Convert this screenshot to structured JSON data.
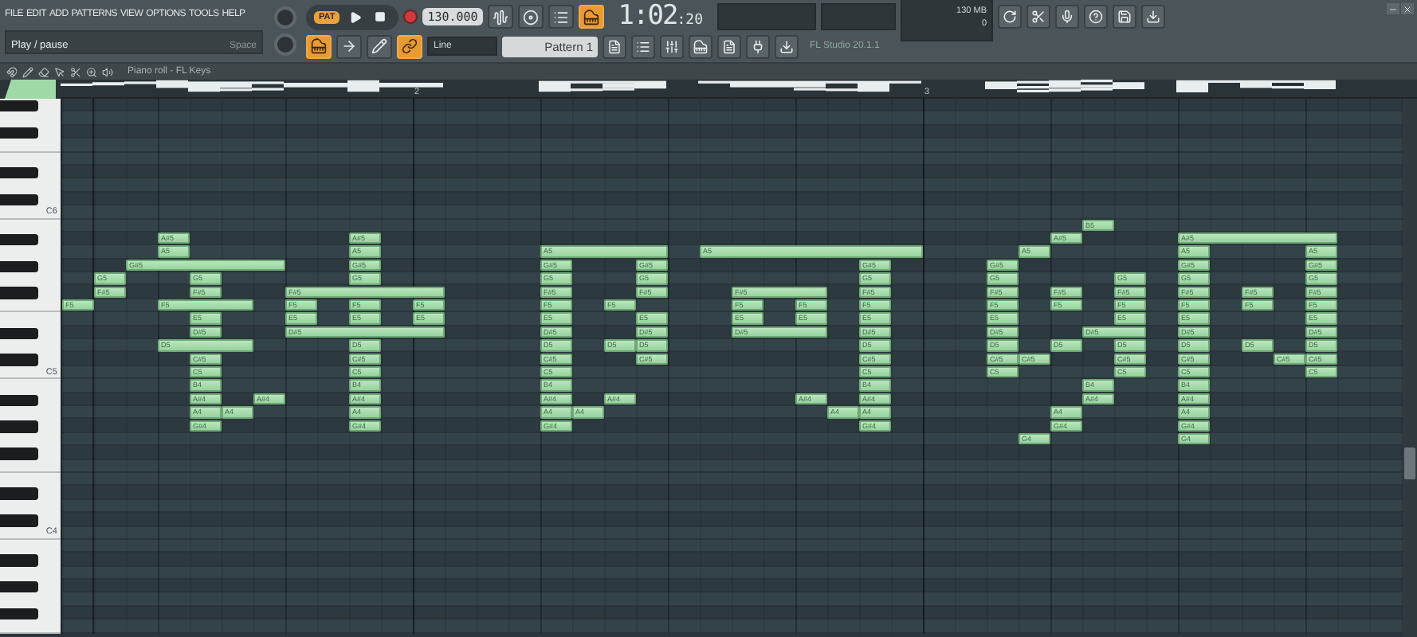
{
  "menu": [
    "FILE",
    "EDIT",
    "ADD",
    "PATTERNS",
    "VIEW",
    "OPTIONS",
    "TOOLS",
    "HELP"
  ],
  "hint": {
    "text": "Play / pause",
    "shortcut": "Space"
  },
  "transport": {
    "mode": "PAT",
    "tempo": "130.000"
  },
  "toggles": [
    {
      "kind": "wave",
      "on": false
    },
    {
      "kind": "tape",
      "on": false
    },
    {
      "kind": "steps",
      "on": false
    },
    {
      "kind": "keys",
      "on": true
    },
    {
      "kind": "keys",
      "on": true
    },
    {
      "kind": "arrow",
      "on": false
    },
    {
      "kind": "pen",
      "on": false
    },
    {
      "kind": "link",
      "on": true
    }
  ],
  "time": {
    "main": "1:02",
    "sub": ":20"
  },
  "cpu": {
    "memory": "130 MB",
    "voices": "0"
  },
  "snap": "Line",
  "pattern": "Pattern 1",
  "hint_right": "FL Studio 20.1.1",
  "piano_roll": {
    "title": "Piano roll - FL Keys",
    "bars": [
      "2",
      "3"
    ],
    "octave_labels": [
      "C6",
      "C5",
      "C4"
    ],
    "notes": [
      {
        "pitch": "A#5"
      },
      {
        "pitch": "A5"
      },
      {
        "pitch": "G#5"
      },
      {
        "pitch": "G5"
      },
      {
        "pitch": "G5"
      },
      {
        "pitch": "F#5"
      },
      {
        "pitch": "F#5"
      },
      {
        "pitch": "F5"
      },
      {
        "pitch": "F5"
      },
      {
        "pitch": "E5"
      },
      {
        "pitch": "D#5"
      },
      {
        "pitch": "D5"
      },
      {
        "pitch": "C#5"
      },
      {
        "pitch": "C5"
      },
      {
        "pitch": "B4"
      },
      {
        "pitch": "A#4"
      },
      {
        "pitch": "A#4"
      },
      {
        "pitch": "A4"
      },
      {
        "pitch": "A4"
      },
      {
        "pitch": "G#4"
      },
      {
        "pitch": "A#5"
      },
      {
        "pitch": "A5"
      },
      {
        "pitch": "G#5"
      },
      {
        "pitch": "G5"
      },
      {
        "pitch": "F#5"
      },
      {
        "pitch": "F5"
      },
      {
        "pitch": "F5"
      },
      {
        "pitch": "F5"
      },
      {
        "pitch": "E5"
      },
      {
        "pitch": "E5"
      },
      {
        "pitch": "E5"
      },
      {
        "pitch": "D#5"
      },
      {
        "pitch": "D5"
      },
      {
        "pitch": "C#5"
      },
      {
        "pitch": "C5"
      },
      {
        "pitch": "B4"
      },
      {
        "pitch": "A#4"
      },
      {
        "pitch": "A4"
      },
      {
        "pitch": "G#4"
      },
      {
        "pitch": "A5"
      },
      {
        "pitch": "G#5"
      },
      {
        "pitch": "G5"
      },
      {
        "pitch": "F#5"
      },
      {
        "pitch": "F5"
      },
      {
        "pitch": "E5"
      },
      {
        "pitch": "D#5"
      },
      {
        "pitch": "D5"
      },
      {
        "pitch": "C#5"
      },
      {
        "pitch": "C5"
      },
      {
        "pitch": "B4"
      },
      {
        "pitch": "A#4"
      },
      {
        "pitch": "A4"
      },
      {
        "pitch": "G#4"
      },
      {
        "pitch": "G#5"
      },
      {
        "pitch": "G5"
      },
      {
        "pitch": "F#5"
      },
      {
        "pitch": "F5"
      },
      {
        "pitch": "E5"
      },
      {
        "pitch": "D#5"
      },
      {
        "pitch": "D5"
      },
      {
        "pitch": "D5"
      },
      {
        "pitch": "C#5"
      },
      {
        "pitch": "A#4"
      },
      {
        "pitch": "A4"
      },
      {
        "pitch": "A5"
      },
      {
        "pitch": "G#5"
      },
      {
        "pitch": "G5"
      },
      {
        "pitch": "F#5"
      },
      {
        "pitch": "F5"
      },
      {
        "pitch": "E5"
      },
      {
        "pitch": "D#5"
      },
      {
        "pitch": "D5"
      },
      {
        "pitch": "C#5"
      },
      {
        "pitch": "C5"
      },
      {
        "pitch": "B4"
      },
      {
        "pitch": "A#4"
      },
      {
        "pitch": "A4"
      },
      {
        "pitch": "G#4"
      },
      {
        "pitch": "F#5"
      },
      {
        "pitch": "F5"
      },
      {
        "pitch": "F5"
      },
      {
        "pitch": "E5"
      },
      {
        "pitch": "E5"
      },
      {
        "pitch": "D#5"
      },
      {
        "pitch": "A#4"
      },
      {
        "pitch": "A4"
      },
      {
        "pitch": "B5"
      },
      {
        "pitch": "A#5"
      },
      {
        "pitch": "A5"
      },
      {
        "pitch": "G#5"
      },
      {
        "pitch": "G5"
      },
      {
        "pitch": "F#5"
      },
      {
        "pitch": "F5"
      },
      {
        "pitch": "E5"
      },
      {
        "pitch": "D#5"
      },
      {
        "pitch": "D5"
      },
      {
        "pitch": "C#5"
      },
      {
        "pitch": "C5"
      },
      {
        "pitch": "C#5"
      },
      {
        "pitch": "F#5"
      },
      {
        "pitch": "F5"
      },
      {
        "pitch": "D5"
      },
      {
        "pitch": "D#5"
      },
      {
        "pitch": "G5"
      },
      {
        "pitch": "F#5"
      },
      {
        "pitch": "F5"
      },
      {
        "pitch": "E5"
      },
      {
        "pitch": "D5"
      },
      {
        "pitch": "C#5"
      },
      {
        "pitch": "C5"
      },
      {
        "pitch": "B4"
      },
      {
        "pitch": "A#4"
      },
      {
        "pitch": "A4"
      },
      {
        "pitch": "G#4"
      },
      {
        "pitch": "G4"
      },
      {
        "pitch": "A#5"
      },
      {
        "pitch": "A5"
      },
      {
        "pitch": "G#5"
      },
      {
        "pitch": "G5"
      },
      {
        "pitch": "F#5"
      },
      {
        "pitch": "F5"
      },
      {
        "pitch": "E5"
      },
      {
        "pitch": "D#5"
      },
      {
        "pitch": "D5"
      },
      {
        "pitch": "C#5"
      },
      {
        "pitch": "C5"
      },
      {
        "pitch": "B4"
      },
      {
        "pitch": "A#4"
      },
      {
        "pitch": "A4"
      },
      {
        "pitch": "G#4"
      },
      {
        "pitch": "G4"
      },
      {
        "pitch": "A5"
      },
      {
        "pitch": "G#5"
      },
      {
        "pitch": "G5"
      },
      {
        "pitch": "F#5"
      },
      {
        "pitch": "F5"
      },
      {
        "pitch": "E5"
      },
      {
        "pitch": "D#5"
      },
      {
        "pitch": "D5"
      },
      {
        "pitch": "C#5"
      },
      {
        "pitch": "C5"
      },
      {
        "pitch": "F#5"
      },
      {
        "pitch": "F5"
      },
      {
        "pitch": "D5"
      },
      {
        "pitch": "C#5"
      }
    ]
  }
}
